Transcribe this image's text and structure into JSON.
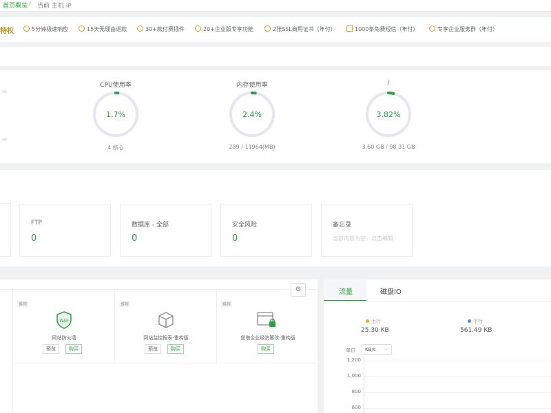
{
  "topbar": {
    "crumb_home": "首页概览",
    "crumb_sep": "/",
    "crumb_current": "当前 主机 IP"
  },
  "perks": {
    "lead": "特权",
    "items": [
      "5分钟极速响应",
      "15天无理由退款",
      "30+款付费插件",
      "20+企业版专享功能",
      "2张SSL商用证书（年付）",
      "1000条免费短信（年付）",
      "专享企业服务群（年付）"
    ]
  },
  "gauges": [
    {
      "title": "CPU使用率",
      "value": "1.7%",
      "percent": 1.7,
      "sub": "4 核心"
    },
    {
      "title": "内存使用率",
      "value": "2.4%",
      "percent": 2.4,
      "sub": "289 / 11964(MB)"
    },
    {
      "title": "/",
      "value": "3.82%",
      "percent": 3.82,
      "sub": "3.60 GB / 98.31 GB"
    }
  ],
  "cards": [
    {
      "title": "FTP",
      "value": "0"
    },
    {
      "title": "数据库 - 全部",
      "value": "0"
    },
    {
      "title": "安全风险",
      "value": "0"
    },
    {
      "title": "备忘录",
      "hint": "当前内容为空，点击编辑"
    }
  ],
  "plugins": [
    {
      "tag": "推荐",
      "name": "网站防火墙",
      "buttons": [
        "预览",
        "购买"
      ],
      "icon": "shield-waf-icon"
    },
    {
      "tag": "推荐",
      "name": "网站监控报表-重构版",
      "buttons": [
        "预览",
        "购买"
      ],
      "icon": "cube-icon"
    },
    {
      "tag": "推荐",
      "name": "堡塔企业级防篡改-重构版",
      "buttons": [
        "购买"
      ],
      "icon": "browser-lock-icon"
    }
  ],
  "traffic": {
    "tabs": [
      "流量",
      "磁盘IO"
    ],
    "active_tab": 0,
    "up_label": "上行",
    "up_value": "25.30 KB",
    "down_label": "下行",
    "down_value": "561.49 KB",
    "unit_label": "单位",
    "unit_value": "KB/s",
    "ticks": [
      "1,200",
      "1,000",
      "800",
      "600"
    ]
  },
  "colors": {
    "accent": "#2ea043",
    "gold": "#c6961e",
    "up": "#f5a623",
    "down": "#4a90e2",
    "ring": "#e6e6f2"
  }
}
